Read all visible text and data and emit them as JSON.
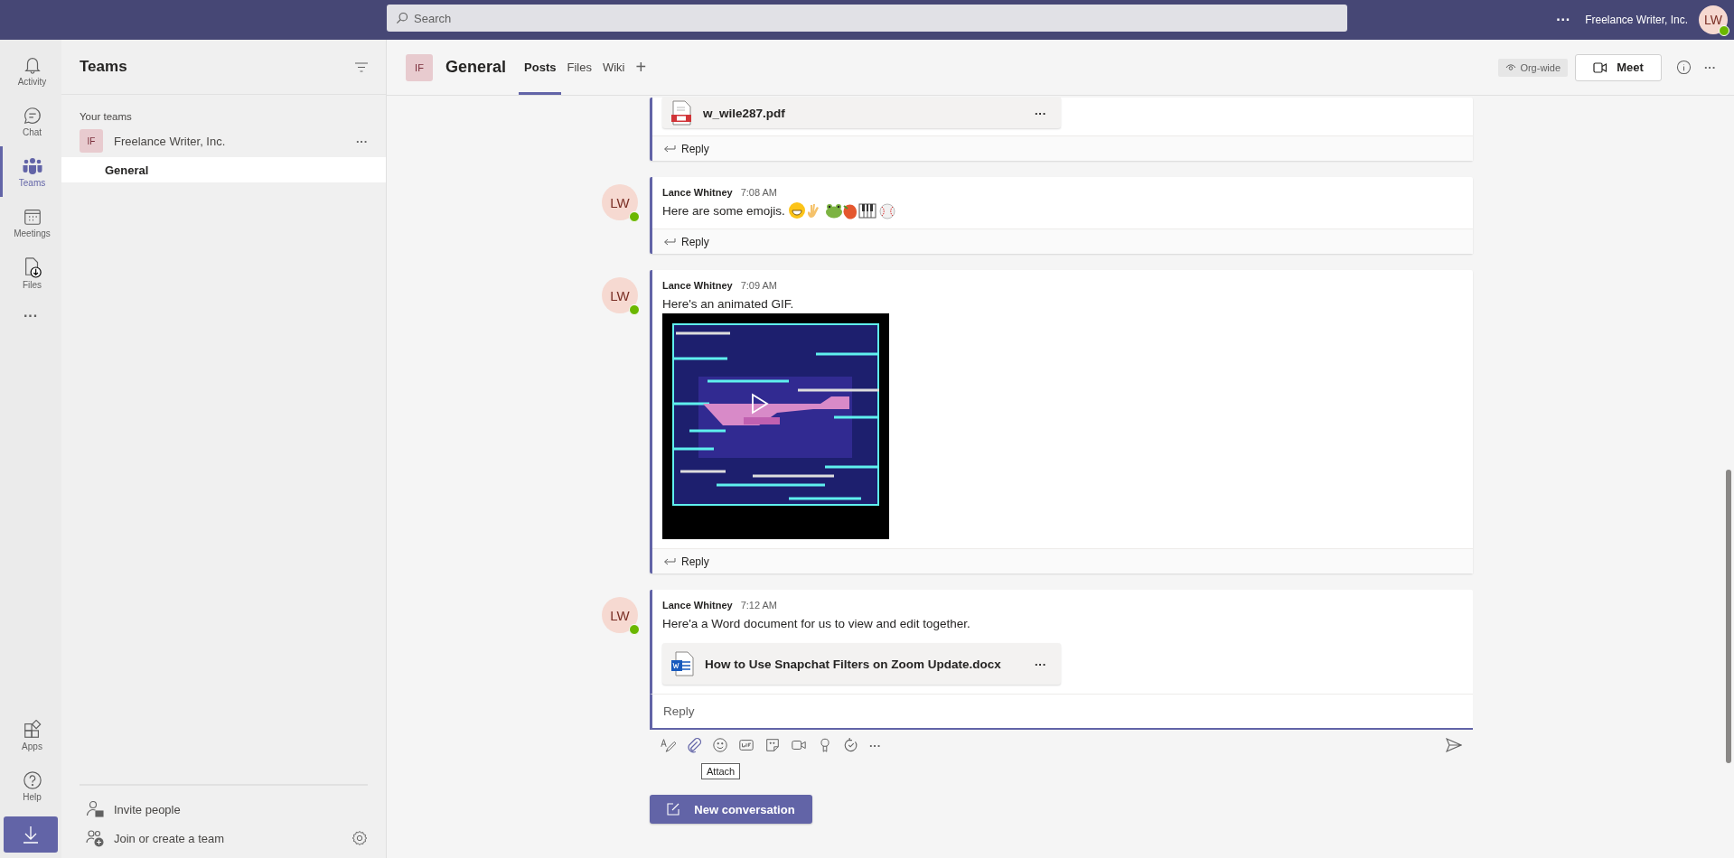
{
  "top_bar": {
    "search": {
      "placeholder": "Search"
    },
    "more": "···",
    "org_name": "Freelance Writer, Inc.",
    "user_initials": "LW"
  },
  "app_bar": {
    "items": [
      {
        "label": "Activity",
        "selected": false
      },
      {
        "label": "Chat",
        "selected": false
      },
      {
        "label": "Teams",
        "selected": true
      },
      {
        "label": "Meetings",
        "selected": false
      },
      {
        "label": "Files",
        "selected": false
      }
    ],
    "more": "···",
    "bottom_items": [
      {
        "label": "Apps"
      },
      {
        "label": "Help"
      }
    ]
  },
  "sidebar": {
    "title": "Teams",
    "section_label": "Your teams",
    "teams": [
      {
        "initials": "IF",
        "name": "Freelance Writer, Inc.",
        "more": "···",
        "channels": [
          {
            "name": "General",
            "selected": true
          }
        ]
      }
    ],
    "footer": [
      {
        "label": "Invite people"
      },
      {
        "label": "Join or create a team"
      }
    ]
  },
  "channel_header": {
    "initials": "IF",
    "title": "General",
    "tabs": [
      {
        "label": "Posts",
        "selected": true
      },
      {
        "label": "Files",
        "selected": false
      },
      {
        "label": "Wiki",
        "selected": false
      }
    ],
    "add_tab": "+",
    "org_badge": "Org-wide",
    "meet_button": "Meet",
    "more": "···"
  },
  "messages": [
    {
      "kind": "file_tail",
      "attachments": [
        {
          "name": "w_wile287.pdf",
          "kind": "pdf",
          "more": "···"
        }
      ],
      "reply": "Reply"
    },
    {
      "kind": "emojis",
      "author": "Lance Whitney",
      "initials": "LW",
      "time": "7:08 AM",
      "text": "Here are some emojis.",
      "reply": "Reply"
    },
    {
      "kind": "gif",
      "author": "Lance Whitney",
      "initials": "LW",
      "time": "7:09 AM",
      "text": "Here's an animated GIF.",
      "reply": "Reply"
    },
    {
      "kind": "file",
      "author": "Lance Whitney",
      "initials": "LW",
      "time": "7:12 AM",
      "text": "Here'a a Word document for us to view and edit together.",
      "attachments": [
        {
          "name": "How to Use Snapchat Filters on Zoom Update.docx",
          "kind": "word",
          "more": "···"
        }
      ],
      "reply_box": {
        "placeholder": "Reply"
      }
    }
  ],
  "composer": {
    "more": "···",
    "tooltip": "Attach"
  },
  "new_conversation_button": "New conversation"
}
